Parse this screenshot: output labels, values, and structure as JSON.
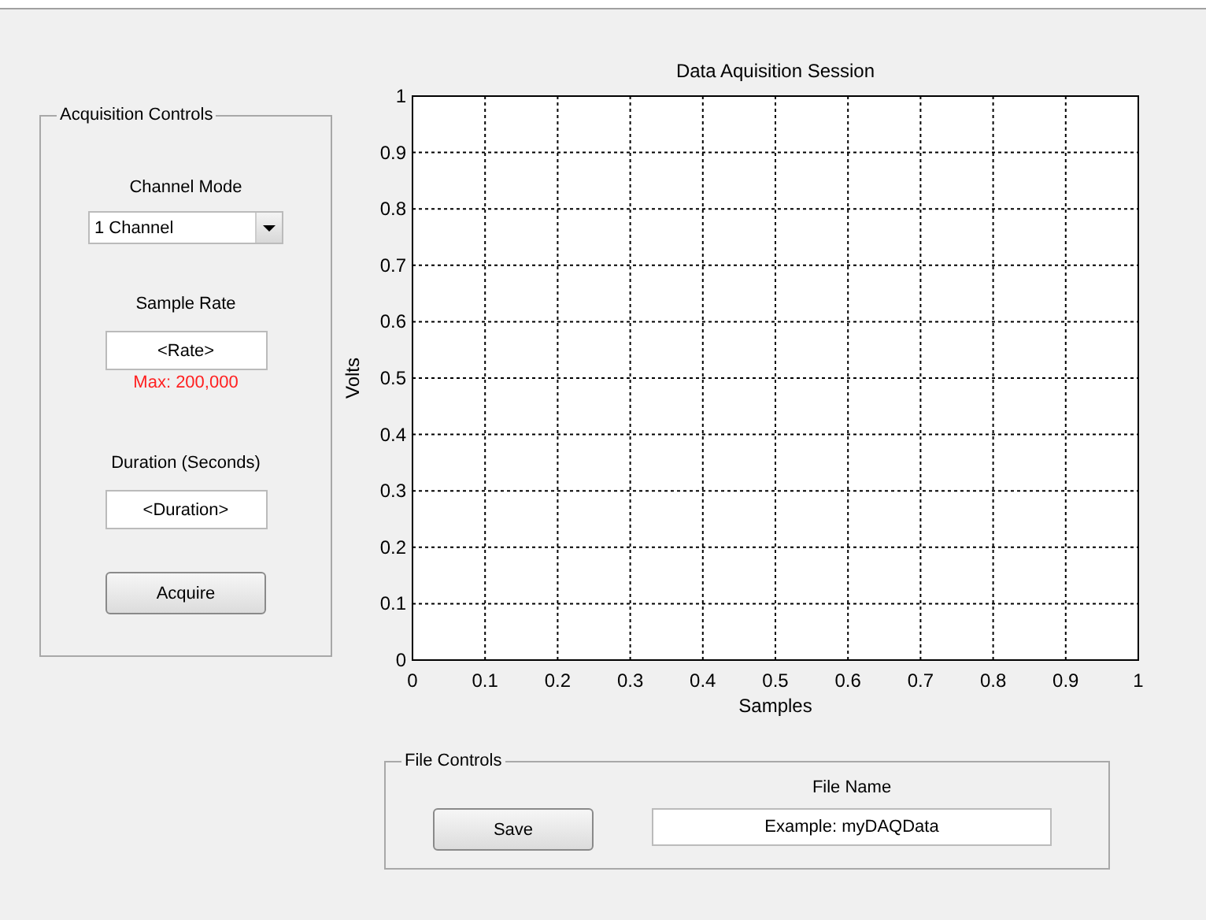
{
  "acquisition_controls": {
    "title": "Acquisition Controls",
    "channel_mode": {
      "label": "Channel Mode",
      "value": "1 Channel"
    },
    "sample_rate": {
      "label": "Sample Rate",
      "value": "<Rate>",
      "hint": "Max: 200,000"
    },
    "duration": {
      "label": "Duration (Seconds)",
      "value": "<Duration>"
    },
    "acquire_button": "Acquire"
  },
  "plot": {
    "chart_data": {
      "type": "line",
      "grid": true,
      "title": "Data Aquisition Session",
      "xlabel": "Samples",
      "ylabel": "Volts",
      "xlim": [
        0,
        1
      ],
      "ylim": [
        0,
        1
      ],
      "xticks": [
        {
          "value": 0,
          "label": "0"
        },
        {
          "value": 0.1,
          "label": "0.1"
        },
        {
          "value": 0.2,
          "label": "0.2"
        },
        {
          "value": 0.3,
          "label": "0.3"
        },
        {
          "value": 0.4,
          "label": "0.4"
        },
        {
          "value": 0.5,
          "label": "0.5"
        },
        {
          "value": 0.6,
          "label": "0.6"
        },
        {
          "value": 0.7,
          "label": "0.7"
        },
        {
          "value": 0.8,
          "label": "0.8"
        },
        {
          "value": 0.9,
          "label": "0.9"
        },
        {
          "value": 1,
          "label": "1"
        }
      ],
      "yticks": [
        {
          "value": 0,
          "label": "0"
        },
        {
          "value": 0.1,
          "label": "0.1"
        },
        {
          "value": 0.2,
          "label": "0.2"
        },
        {
          "value": 0.3,
          "label": "0.3"
        },
        {
          "value": 0.4,
          "label": "0.4"
        },
        {
          "value": 0.5,
          "label": "0.5"
        },
        {
          "value": 0.6,
          "label": "0.6"
        },
        {
          "value": 0.7,
          "label": "0.7"
        },
        {
          "value": 0.8,
          "label": "0.8"
        },
        {
          "value": 0.9,
          "label": "0.9"
        },
        {
          "value": 1,
          "label": "1"
        }
      ]
    }
  },
  "file_controls": {
    "title": "File Controls",
    "save_button": "Save",
    "file_name": {
      "label": "File Name",
      "value": "Example: myDAQData"
    }
  }
}
